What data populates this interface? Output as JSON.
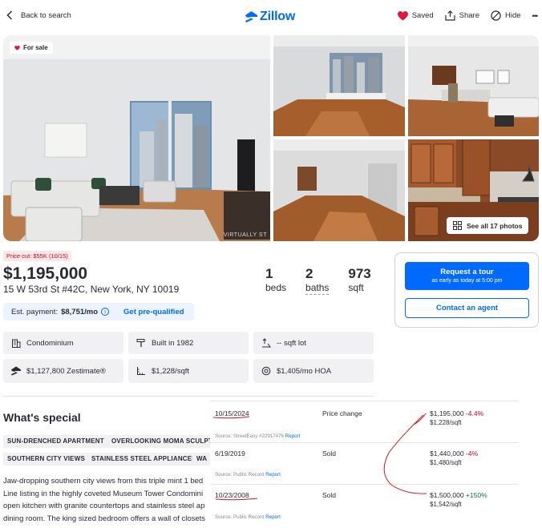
{
  "header": {
    "back_label": "Back to search",
    "logo_text": "Zillow",
    "saved_label": "Saved",
    "share_label": "Share",
    "hide_label": "Hide",
    "more_label": "•••"
  },
  "photos": {
    "badge": "For sale",
    "watermark": "VIRTUALLY ST",
    "see_all": "See all 17 photos"
  },
  "listing": {
    "price_cut": "Price cut: $55K (10/15)",
    "price": "$1,195,000",
    "address": "15 W 53rd St #42C, New York, NY 10019",
    "beds_num": "1",
    "beds_label": "beds",
    "baths_num": "2",
    "baths_label": "baths",
    "sqft_num": "973",
    "sqft_label": "sqft",
    "est_label": "Est. payment:",
    "est_value": "$8,751/mo",
    "pre_qualified": "Get pre-qualified"
  },
  "tour": {
    "request_label": "Request a tour",
    "request_sub": "as early as today at 5:00 pm",
    "contact_label": "Contact an agent"
  },
  "facts": [
    {
      "icon": "building-icon",
      "text": "Condominium"
    },
    {
      "icon": "hammer-icon",
      "text": "Built in 1982"
    },
    {
      "icon": "lot-icon",
      "text": "-- sqft lot"
    },
    {
      "icon": "zestimate-icon",
      "text": "$1,127,800 Zestimate®"
    },
    {
      "icon": "ruler-icon",
      "text": "$1,228/sqft"
    },
    {
      "icon": "hoa-icon",
      "text": "$1,405/mo HOA"
    }
  ],
  "special": {
    "heading": "What's special",
    "tags": [
      "SUN-DRENCHED APARTMENT",
      "OVERLOOKING MOMA SCULPT",
      "SOUTHERN CITY VIEWS",
      "STAINLESS STEEL APPLIANCES",
      "WA"
    ],
    "description": [
      "Jaw-dropping southern city views from this triple mint 1 bed",
      "Line listing in the highly coveted Museum Tower Condomini",
      "open kitchen with granite countertops and stainless steel ap",
      "dining room. The king sized bedroom offers a wall of closets"
    ]
  },
  "price_history": [
    {
      "date": "10/15/2024",
      "event": "Price change",
      "price": "$1,195,000",
      "change": "-4.4%",
      "sqft": "$1,228/sqft",
      "source": "Source: StreetEasy #22917476",
      "report": "Report"
    },
    {
      "date": "6/19/2019",
      "event": "Sold",
      "price": "$1,440,000",
      "change": "-4%",
      "sqft": "$1,480/sqft",
      "source": "Source: Public Record",
      "report": "Report"
    },
    {
      "date": "10/23/2008",
      "event": "Sold",
      "price": "$1,500,000",
      "change": "+150%",
      "sqft": "$1,542/sqft",
      "source": "Source: Public Record",
      "report": "Report"
    }
  ],
  "colors": {
    "brand": "#006aff",
    "negative": "#c9002b",
    "positive": "#0b7a3d",
    "annotation": "#d4161b"
  }
}
